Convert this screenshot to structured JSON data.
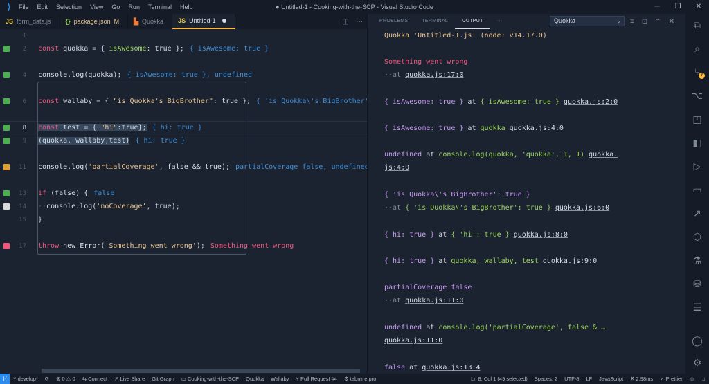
{
  "window": {
    "title": "● Untitled-1 - Cooking-with-the-SCP - Visual Studio Code",
    "menu": [
      "File",
      "Edit",
      "Selection",
      "View",
      "Go",
      "Run",
      "Terminal",
      "Help"
    ]
  },
  "tabs": [
    {
      "label": "form_data.js",
      "icon": "js-file-icon",
      "modified": ""
    },
    {
      "label": "package.json",
      "icon": "json-file-icon",
      "modified": "M"
    },
    {
      "label": "Quokka",
      "icon": "quokka-icon",
      "modified": ""
    },
    {
      "label": "Untitled-1",
      "icon": "js-file-icon",
      "modified": ""
    }
  ],
  "editor": {
    "line_numbers": [
      "1",
      "2",
      "4",
      "6",
      "8",
      "9",
      "11",
      "13",
      "14",
      "15",
      "17"
    ],
    "inline": {
      "l2": "{ isAwesome: true }",
      "l4": "{ isAwesome: true }, undefined",
      "l6": "{ 'is Quokka\\'s BigBrother': t",
      "l8": "{ hi: true }",
      "l9": "{ hi: true }",
      "l11": "partialCoverage false, undefined",
      "l13": "false",
      "l17": "Something went wrong"
    }
  },
  "panel": {
    "tabs": [
      "PROBLEMS",
      "TERMINAL",
      "OUTPUT",
      "···"
    ],
    "active_tab": "OUTPUT",
    "channel": "Quokka",
    "output": {
      "header": "Quokka 'Untitled-1.js' (node: v14.17.0)",
      "err_msg": "Something went wrong",
      "at": "··at",
      "at_word": "at",
      "loc_17": "quokka.js:17:0",
      "obj_awesome": "{ isAwesome: true }",
      "loc_2": "quokka.js:2:0",
      "quokka_word": "quokka",
      "loc_4": "quokka.js:4:0",
      "undefined": "undefined",
      "console_call": "console.log(quokka, 'quokka', 1, 1)",
      "loc_4a": "quokka.",
      "loc_4b": "js:4:0",
      "obj_quokka_open": "{ 'is Quokka\\'s BigBrother': true }",
      "loc_6": "quokka.js:6:0",
      "obj_hi": "{ hi: true }",
      "obj_hi_str": "{ 'hi': true }",
      "loc_8": "quokka.js:8:0",
      "triple": "quokka, wallaby, test",
      "loc_9": "quokka.js:9:0",
      "partial": "partialCoverage false",
      "loc_11": "quokka.js:11:0",
      "console_partial": "console.log('partialCoverage', false & …",
      "false_word": "false",
      "loc_13": "quokka.js:13:4"
    }
  },
  "status": {
    "branch": "develop*",
    "errors": "0",
    "warnings": "0",
    "connect": "Connect",
    "live_share": "Live Share",
    "git_graph": "Git Graph",
    "folder": "Cooking-with-the-SCP",
    "quokka": "Quokka",
    "wallaby": "Wallaby",
    "pull_request": "Pull Request #4",
    "tabnine": "tabnine pro",
    "cursor": "Ln 8, Col 1 (49 selected)",
    "spaces": "Spaces: 2",
    "encoding": "UTF-8",
    "eol": "LF",
    "language": "JavaScript",
    "timing": "✗ 2.98ms",
    "prettier": "✓ Prettier"
  },
  "colors": {
    "covered": "#4caf50",
    "partial": "#e0a030",
    "uncovered": "#d9d9d9",
    "error": "#f2547a",
    "accent_tab": "#ffb83f"
  }
}
